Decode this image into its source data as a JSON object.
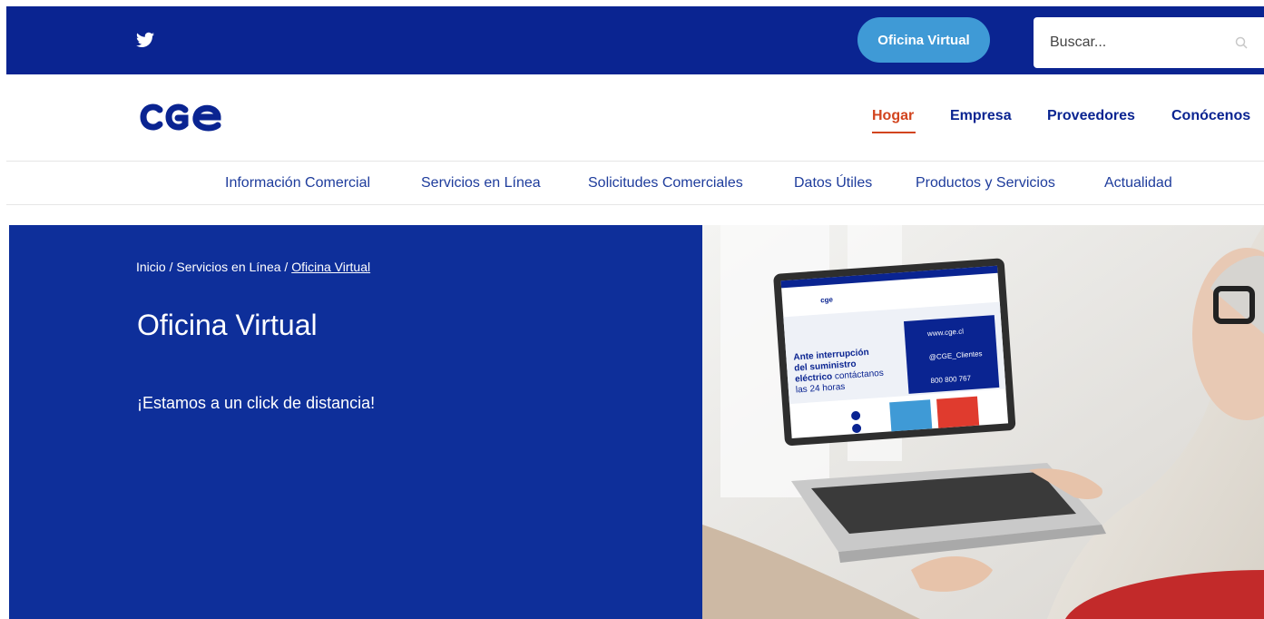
{
  "topbar": {
    "twitter_icon": "twitter-icon",
    "oficina_virtual_label": "Oficina Virtual",
    "search_placeholder": "Buscar...",
    "search_icon": "search-icon",
    "bg_color": "#0a2491",
    "button_color": "#3f9ad6"
  },
  "header": {
    "logo_text": "CGE",
    "nav": [
      {
        "label": "Hogar",
        "active": true
      },
      {
        "label": "Empresa"
      },
      {
        "label": "Proveedores"
      },
      {
        "label": "Conócenos"
      }
    ],
    "accent_color": "#d2441e"
  },
  "subnav": [
    {
      "label": "Información Comercial"
    },
    {
      "label": "Servicios en Línea"
    },
    {
      "label": "Solicitudes Comerciales"
    },
    {
      "label": "Datos Útiles"
    },
    {
      "label": "Productos y Servicios"
    },
    {
      "label": "Actualidad"
    }
  ],
  "hero": {
    "breadcrumb": [
      {
        "label": "Inicio"
      },
      {
        "label": "Servicios en Línea"
      },
      {
        "label": "Oficina Virtual"
      }
    ],
    "breadcrumb_sep": " / ",
    "title": "Oficina Virtual",
    "subtitle": "¡Estamos a un click de distancia!",
    "bg_color": "#0e2f9a",
    "image": {
      "screen_logo": "cge",
      "screen_headline_bold": "Ante interrupción del suministro eléctrico",
      "screen_headline_rest": "contáctanos las 24 horas",
      "contact_web": "www.cge.cl",
      "contact_twitter": "@CGE_Clientes",
      "contact_phone": "800 800 767"
    }
  }
}
